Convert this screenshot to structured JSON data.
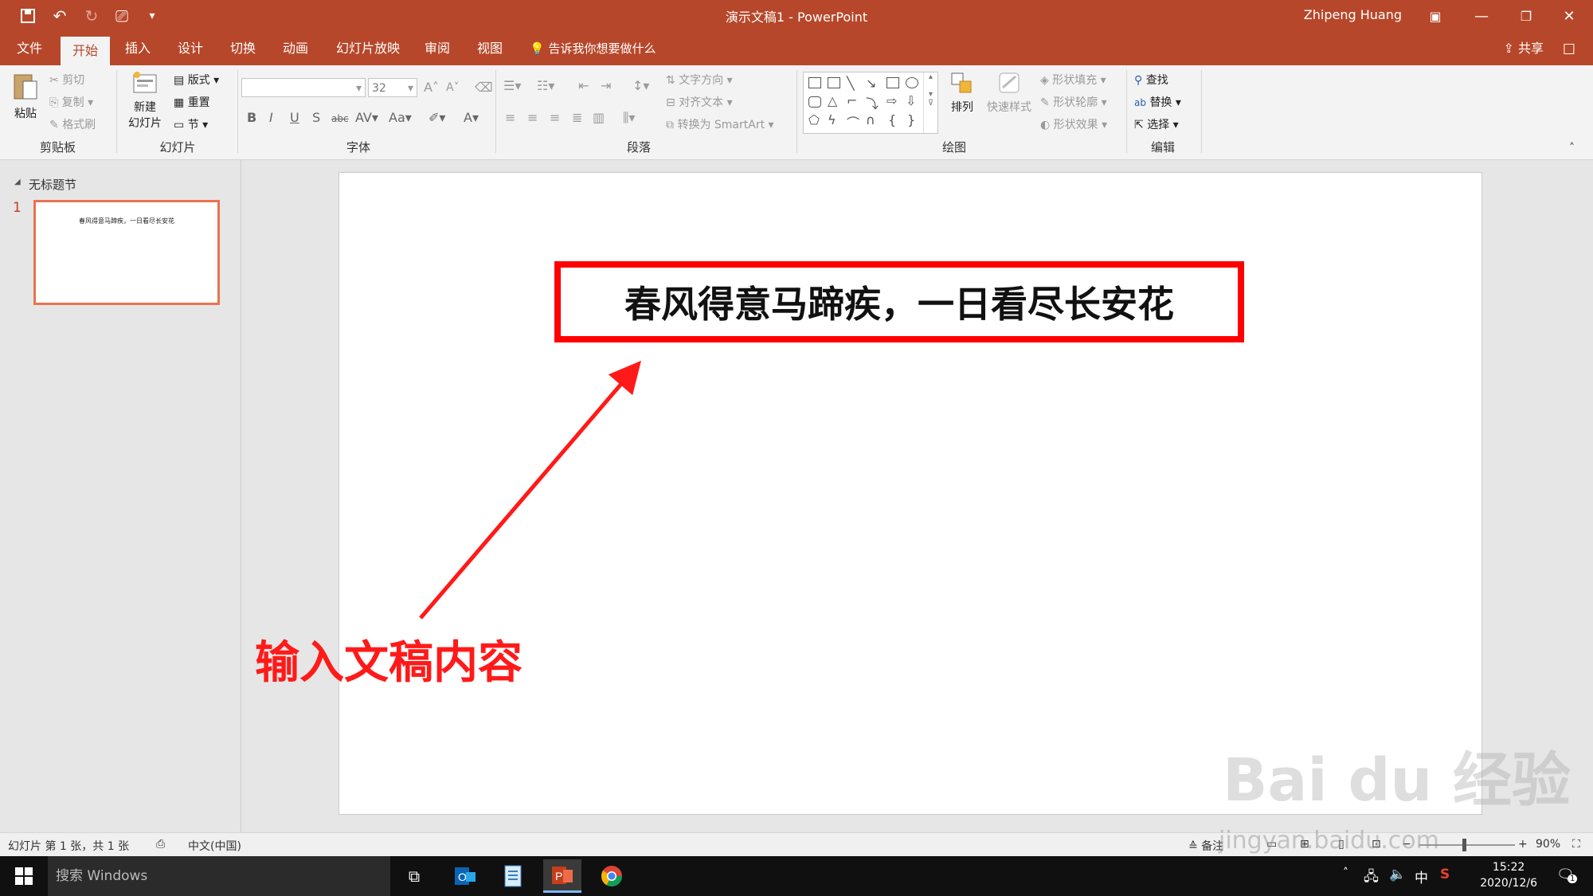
{
  "app": {
    "doc_title": "演示文稿1  -  PowerPoint",
    "user_name": "Zhipeng Huang"
  },
  "tabs": [
    {
      "label": "文件",
      "active": false
    },
    {
      "label": "开始",
      "active": true
    },
    {
      "label": "插入",
      "active": false
    },
    {
      "label": "设计",
      "active": false
    },
    {
      "label": "切换",
      "active": false
    },
    {
      "label": "动画",
      "active": false
    },
    {
      "label": "幻灯片放映",
      "active": false
    },
    {
      "label": "审阅",
      "active": false
    },
    {
      "label": "视图",
      "active": false
    }
  ],
  "tell_me": "告诉我你想要做什么",
  "share_label": "共享",
  "ribbon": {
    "clipboard": {
      "label": "剪贴板",
      "paste": "粘贴",
      "cut": "剪切",
      "copy": "复制",
      "format_painter": "格式刷"
    },
    "slides": {
      "label": "幻灯片",
      "new_slide_1": "新建",
      "new_slide_2": "幻灯片",
      "layout": "版式",
      "reset": "重置",
      "section": "节"
    },
    "font": {
      "label": "字体",
      "font_size": "32"
    },
    "paragraph": {
      "label": "段落",
      "text_direction": "文字方向",
      "align_text": "对齐文本",
      "convert_smartart": "转换为 SmartArt"
    },
    "drawing": {
      "label": "绘图",
      "arrange": "排列",
      "quick_styles": "快速样式",
      "shape_fill": "形状填充",
      "shape_outline": "形状轮廓",
      "shape_effects": "形状效果"
    },
    "editing": {
      "label": "编辑",
      "find": "查找",
      "replace": "替换",
      "select": "选择"
    }
  },
  "left_panel": {
    "section_name": "无标题节",
    "slide_number": "1",
    "thumb_text": "春风得意马蹄疾，一日看尽长安花"
  },
  "slide": {
    "title_text": "春风得意马蹄疾，一日看尽长安花",
    "annotation": "输入文稿内容"
  },
  "status": {
    "slide_info": "幻灯片 第 1 张，共 1 张",
    "language": "中文(中国)",
    "notes": "备注",
    "zoom": "90%"
  },
  "taskbar": {
    "search_placeholder": "搜索 Windows",
    "ime": "中",
    "time": "15:22",
    "date": "2020/12/6",
    "notification_count": "1"
  },
  "watermark": {
    "brand": "Bai du 经验",
    "url": "jingyan.baidu.com"
  },
  "colors": {
    "accent": "#b7472a",
    "annotation_red": "#ff1a1a"
  }
}
